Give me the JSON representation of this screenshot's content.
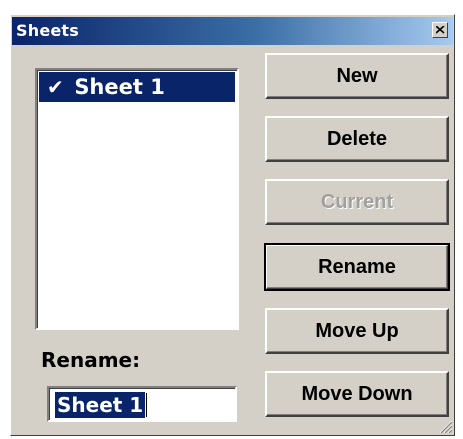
{
  "window": {
    "title": "Sheets"
  },
  "sheets_list": {
    "items": [
      {
        "check": "✔",
        "label": "Sheet 1",
        "selected": true
      }
    ]
  },
  "rename": {
    "label": "Rename:",
    "value": "Sheet 1"
  },
  "buttons": {
    "new_label": "New",
    "delete_label": "Delete",
    "current_label": "Current",
    "rename_label": "Rename",
    "move_up_label": "Move Up",
    "move_down_label": "Move Down"
  },
  "colors": {
    "dialog_face": "#d4d0c8",
    "title_active": "#0a246a",
    "selection": "#0a246a",
    "disabled_text": "#a0a0a0"
  },
  "icons": {
    "close": "close-icon",
    "check": "checkmark-icon",
    "resize": "resize-grip-icon"
  }
}
